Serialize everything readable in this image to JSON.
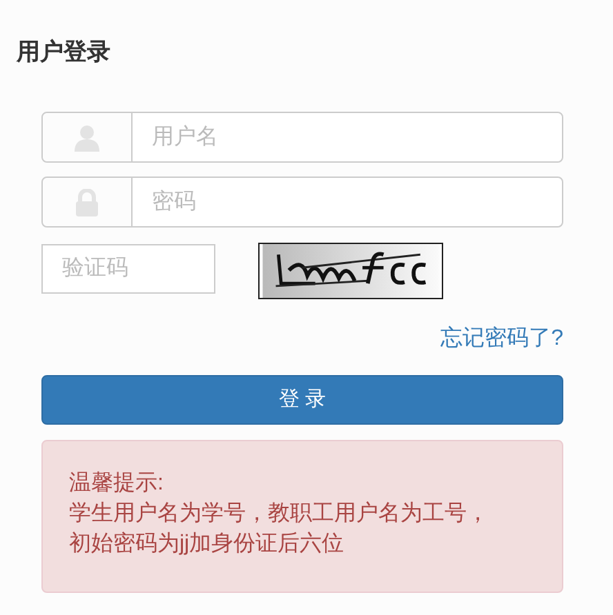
{
  "title": "用户登录",
  "fields": [
    {
      "kind": "user",
      "placeholder": "用户名"
    },
    {
      "kind": "lock",
      "placeholder": "密码"
    }
  ],
  "captcha": {
    "placeholder": "验证码"
  },
  "forgot_link": "忘记密码了?",
  "login_button": "登 录",
  "notice": {
    "title": "温馨提示:",
    "lines": [
      "学生用户名为学号，教职工用户名为工号，",
      "初始密码为jj加身份证后六位"
    ]
  }
}
